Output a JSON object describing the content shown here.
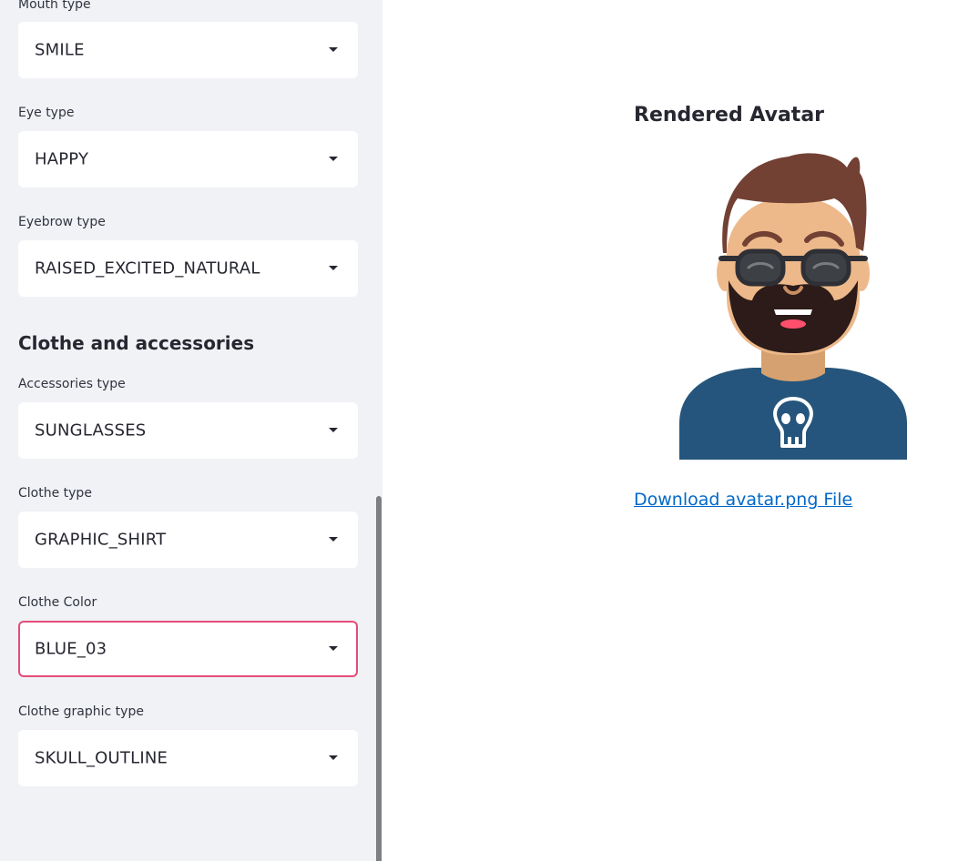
{
  "sidebar": {
    "fields": [
      {
        "label": "Mouth type",
        "value": "SMILE"
      },
      {
        "label": "Eye type",
        "value": "HAPPY"
      },
      {
        "label": "Eyebrow type",
        "value": "RAISED_EXCITED_NATURAL"
      },
      {
        "label": "Accessories type",
        "value": "SUNGLASSES"
      },
      {
        "label": "Clothe type",
        "value": "GRAPHIC_SHIRT"
      },
      {
        "label": "Clothe Color",
        "value": "BLUE_03"
      },
      {
        "label": "Clothe graphic type",
        "value": "SKULL_OUTLINE"
      }
    ],
    "section_heading": "Clothe and accessories"
  },
  "main": {
    "title": "Rendered Avatar",
    "download_label": "Download avatar.png File"
  },
  "colors": {
    "accent_focus": "#e54c7a",
    "link": "#0068c9",
    "sidebar_bg": "#f0f2f6",
    "shirt": "#25557c",
    "hair": "#724133",
    "skin": "#edb98a"
  },
  "icons": [
    "chevron-down-icon",
    "skull-graphic"
  ]
}
